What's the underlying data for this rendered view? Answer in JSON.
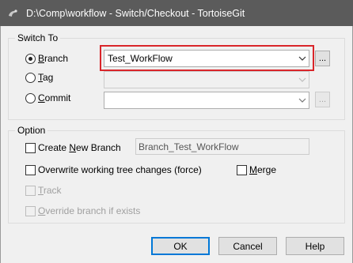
{
  "window": {
    "title": "D:\\Comp\\workflow - Switch/Checkout - TortoiseGit"
  },
  "switch_to": {
    "group_label": "Switch To",
    "branch_label_ul": "B",
    "branch_label_rest": "ranch",
    "branch_value": "Test_WorkFlow",
    "tag_label_ul": "T",
    "tag_label_rest": "ag",
    "tag_value": "",
    "commit_label_ul": "C",
    "commit_label_rest": "ommit",
    "commit_value": "",
    "browse_label": "...",
    "selected": "branch"
  },
  "option": {
    "group_label": "Option",
    "create_branch_pre": "Create ",
    "create_branch_ul": "N",
    "create_branch_post": "ew Branch",
    "create_branch_checked": false,
    "new_branch_name": "Branch_Test_WorkFlow",
    "overwrite_label": "Overwrite working tree changes (force)",
    "overwrite_checked": false,
    "merge_ul": "M",
    "merge_rest": "erge",
    "merge_checked": false,
    "track_ul": "T",
    "track_rest": "rack",
    "override_ul": "O",
    "override_rest": "verride branch if exists"
  },
  "buttons": {
    "ok": "OK",
    "cancel": "Cancel",
    "help": "Help"
  }
}
